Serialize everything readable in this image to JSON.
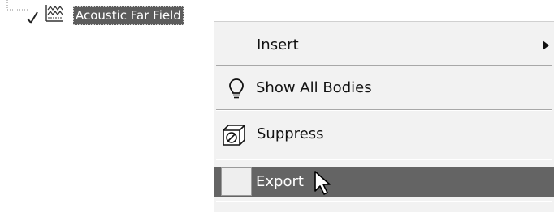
{
  "tree": {
    "node_label": "Acoustic Far Field",
    "node_icon": "waveform-chart-icon",
    "status_icon": "check-icon",
    "connector": "tree-connector-dotted"
  },
  "context_menu": {
    "items": [
      {
        "label": "Insert",
        "icon": null,
        "has_submenu": true,
        "submenu_icon": "caret-right-icon"
      },
      {
        "label": "Show All Bodies",
        "icon": "lightbulb-icon"
      },
      {
        "label": "Suppress",
        "icon": "suppress-body-icon"
      },
      {
        "label": "Export",
        "icon": "blank-icon-box",
        "highlighted": true
      }
    ],
    "highlight_color": "#646464"
  },
  "cursor": "arrow-cursor-icon"
}
